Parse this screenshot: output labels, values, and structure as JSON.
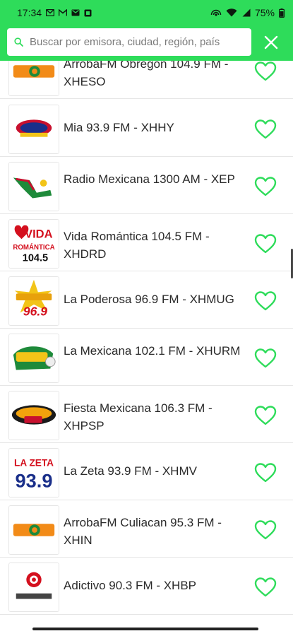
{
  "status_bar": {
    "time": "17:34",
    "battery": "75%",
    "notification_icons": [
      "mail-icon",
      "gmail-icon",
      "mail-icon",
      "image-icon"
    ],
    "system_icons": [
      "hotspot-icon",
      "wifi-icon",
      "signal-icon",
      "battery-icon"
    ]
  },
  "search": {
    "placeholder": "Buscar por emisora, ciudad, región, país",
    "value": ""
  },
  "colors": {
    "accent": "#2edc5a",
    "heart": "#2edc5a"
  },
  "stations": [
    {
      "name": "ArrobaFM Obregon 104.9 FM - XHESO",
      "logo": "arrobafm-logo"
    },
    {
      "name": "Mia 93.9 FM - XHHY",
      "logo": "mia-logo"
    },
    {
      "name": "Radio Mexicana 1300 AM - XEP",
      "logo": "radio-mexicana-logo"
    },
    {
      "name": "Vida Romántica 104.5 FM - XHDRD",
      "logo": "vida-romantica-logo",
      "logo_text": [
        "VIDA",
        "ROMÁNTICA",
        "104.5"
      ]
    },
    {
      "name": "La Poderosa 96.9 FM - XHMUG",
      "logo": "la-poderosa-logo",
      "logo_text": [
        "96.9"
      ]
    },
    {
      "name": "La Mexicana 102.1 FM - XHURM",
      "logo": "la-mexicana-logo"
    },
    {
      "name": "Fiesta Mexicana 106.3 FM - XHPSP",
      "logo": "fiesta-mexicana-logo"
    },
    {
      "name": "La Zeta 93.9 FM - XHMV",
      "logo": "la-zeta-logo",
      "logo_text": [
        "LA ZETA",
        "93.9"
      ]
    },
    {
      "name": "ArrobaFM Culiacan 95.3 FM - XHIN",
      "logo": "arrobafm-logo"
    },
    {
      "name": "Adictivo 90.3 FM - XHBP",
      "logo": "adictivo-logo"
    }
  ]
}
